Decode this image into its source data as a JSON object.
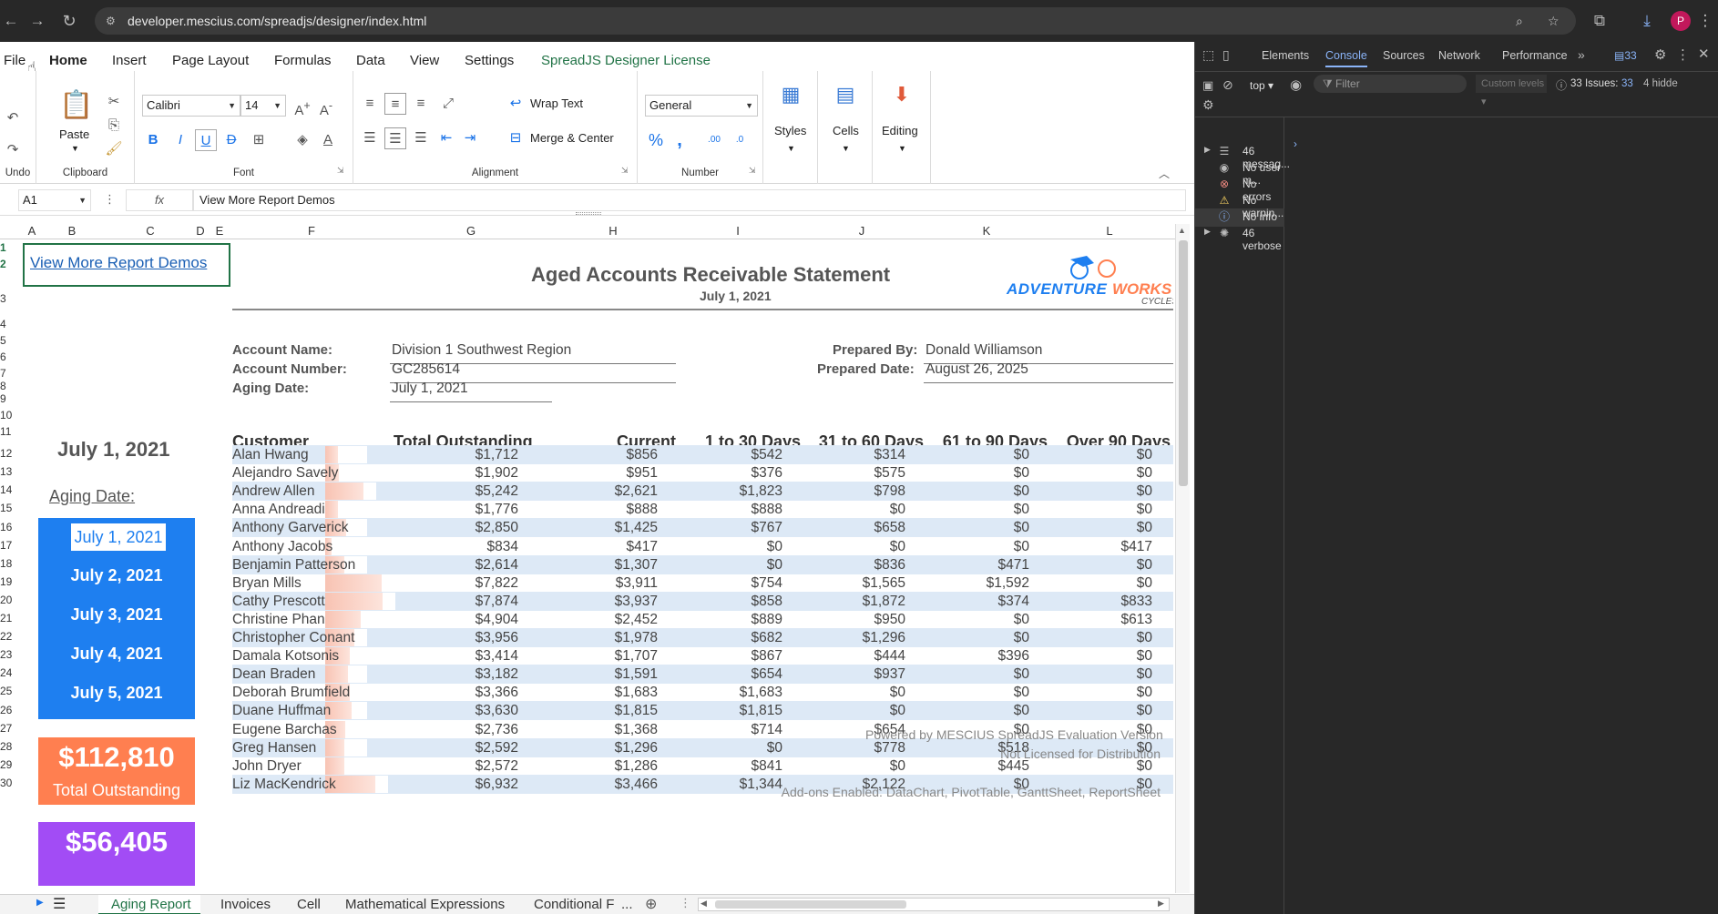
{
  "browser": {
    "url": "developer.mescius.com/spreadjs/designer/index.html",
    "avatar": "P"
  },
  "menu": {
    "items": [
      "File",
      "Home",
      "Insert",
      "Page Layout",
      "Formulas",
      "Data",
      "View",
      "Settings",
      "SpreadJS Designer License"
    ]
  },
  "ribbon": {
    "groups": [
      "Undo",
      "Clipboard",
      "Font",
      "Alignment",
      "Number"
    ],
    "paste": "Paste",
    "font_name": "Calibri",
    "font_size": "14",
    "wrap_text": "Wrap Text",
    "merge_center": "Merge & Center",
    "number_format": "General",
    "styles": "Styles",
    "cells": "Cells",
    "editing": "Editing"
  },
  "formula": {
    "cell_ref": "A1",
    "fx": "fx",
    "content": "View More Report Demos"
  },
  "columns": [
    "A",
    "B",
    "C",
    "D",
    "E",
    "F",
    "G",
    "H",
    "I",
    "J",
    "K",
    "L"
  ],
  "rows": [
    "1",
    "2",
    "3",
    "4",
    "5",
    "6",
    "7",
    "8",
    "9",
    "10",
    "11",
    "12",
    "13",
    "14",
    "15",
    "16",
    "17",
    "18",
    "19",
    "20",
    "21",
    "22",
    "23",
    "24",
    "25",
    "26",
    "27",
    "28",
    "29",
    "30"
  ],
  "report": {
    "link": "View More Report Demos",
    "title": "Aged Accounts Receivable Statement",
    "date": "July 1, 2021",
    "logo_adv": "ADVENTURE",
    "logo_works": "WORKS",
    "logo_cycles": "CYCLES",
    "account_name_label": "Account Name:",
    "account_name": "Division 1 Southwest Region",
    "account_number_label": "Account Number:",
    "account_number": "GC285614",
    "aging_date_label": "Aging Date:",
    "aging_date": "July 1, 2021",
    "prepared_by_label": "Prepared By:",
    "prepared_by": "Donald Williamson",
    "prepared_date_label": "Prepared Date:",
    "prepared_date": "August 26, 2025",
    "side_date": "July 1, 2021",
    "side_aging_label": "Aging Date:",
    "date_buttons": [
      "July 1, 2021",
      "July 2, 2021",
      "July 3, 2021",
      "July 4, 2021",
      "July 5, 2021"
    ],
    "total_outstanding_value": "$112,810",
    "total_outstanding_label": "Total Outstanding",
    "current_value": "$56,405"
  },
  "table": {
    "headers": [
      "Customer",
      "Total Outstanding",
      "Current",
      "1 to 30 Days",
      "31 to 60 Days",
      "61 to 90 Days",
      "Over 90 Days"
    ],
    "rows": [
      [
        "Alan Hwang",
        "$1,712",
        "$856",
        "$542",
        "$314",
        "$0",
        "$0"
      ],
      [
        "Alejandro Savely",
        "$1,902",
        "$951",
        "$376",
        "$575",
        "$0",
        "$0"
      ],
      [
        "Andrew Allen",
        "$5,242",
        "$2,621",
        "$1,823",
        "$798",
        "$0",
        "$0"
      ],
      [
        "Anna Andreadi",
        "$1,776",
        "$888",
        "$888",
        "$0",
        "$0",
        "$0"
      ],
      [
        "Anthony Garverick",
        "$2,850",
        "$1,425",
        "$767",
        "$658",
        "$0",
        "$0"
      ],
      [
        "Anthony Jacobs",
        "$834",
        "$417",
        "$0",
        "$0",
        "$0",
        "$417"
      ],
      [
        "Benjamin Patterson",
        "$2,614",
        "$1,307",
        "$0",
        "$836",
        "$471",
        "$0"
      ],
      [
        "Bryan Mills",
        "$7,822",
        "$3,911",
        "$754",
        "$1,565",
        "$1,592",
        "$0"
      ],
      [
        "Cathy Prescott",
        "$7,874",
        "$3,937",
        "$858",
        "$1,872",
        "$374",
        "$833"
      ],
      [
        "Christine Phan",
        "$4,904",
        "$2,452",
        "$889",
        "$950",
        "$0",
        "$613"
      ],
      [
        "Christopher Conant",
        "$3,956",
        "$1,978",
        "$682",
        "$1,296",
        "$0",
        "$0"
      ],
      [
        "Damala Kotsonis",
        "$3,414",
        "$1,707",
        "$867",
        "$444",
        "$396",
        "$0"
      ],
      [
        "Dean Braden",
        "$3,182",
        "$1,591",
        "$654",
        "$937",
        "$0",
        "$0"
      ],
      [
        "Deborah Brumfield",
        "$3,366",
        "$1,683",
        "$1,683",
        "$0",
        "$0",
        "$0"
      ],
      [
        "Duane Huffman",
        "$3,630",
        "$1,815",
        "$1,815",
        "$0",
        "$0",
        "$0"
      ],
      [
        "Eugene Barchas",
        "$2,736",
        "$1,368",
        "$714",
        "$654",
        "$0",
        "$0"
      ],
      [
        "Greg Hansen",
        "$2,592",
        "$1,296",
        "$0",
        "$778",
        "$518",
        "$0"
      ],
      [
        "John Dryer",
        "$2,572",
        "$1,286",
        "$841",
        "$0",
        "$445",
        "$0"
      ],
      [
        "Liz MacKendrick",
        "$6,932",
        "$3,466",
        "$1,344",
        "$2,122",
        "$0",
        "$0"
      ]
    ],
    "bar_fractions": [
      0.22,
      0.24,
      0.67,
      0.23,
      0.36,
      0.11,
      0.33,
      0.99,
      1.0,
      0.62,
      0.5,
      0.43,
      0.4,
      0.43,
      0.46,
      0.35,
      0.33,
      0.33,
      0.88
    ]
  },
  "watermark": {
    "line1": "Powered by MESCIUS SpreadJS Evaluation Version",
    "line2": "Not Licensed for Distribution",
    "line3": "Add-ons Enabled: DataChart, PivotTable, GanttSheet, ReportSheet"
  },
  "tabs": [
    "Aging Report",
    "Invoices",
    "Cell",
    "Mathematical Expressions",
    "Conditional F",
    "..."
  ],
  "devtools": {
    "tabs": [
      "Elements",
      "Console",
      "Sources",
      "Network",
      "Performance"
    ],
    "issues_badge": "33",
    "context": "top",
    "filter_placeholder": "Filter",
    "levels": "Custom levels",
    "issues_text": "33 Issues:",
    "issues_count": "33",
    "hidden": "4 hidde",
    "messages": [
      "46 messag...",
      "No user m...",
      "No errors",
      "No warnin...",
      "No info",
      "46 verbose"
    ]
  },
  "colors": {
    "accent_blue": "#1e7ff0",
    "orange": "#ff7f50",
    "purple": "#a24cf5",
    "stripe": "#dde9f6",
    "license_green": "#217346"
  }
}
